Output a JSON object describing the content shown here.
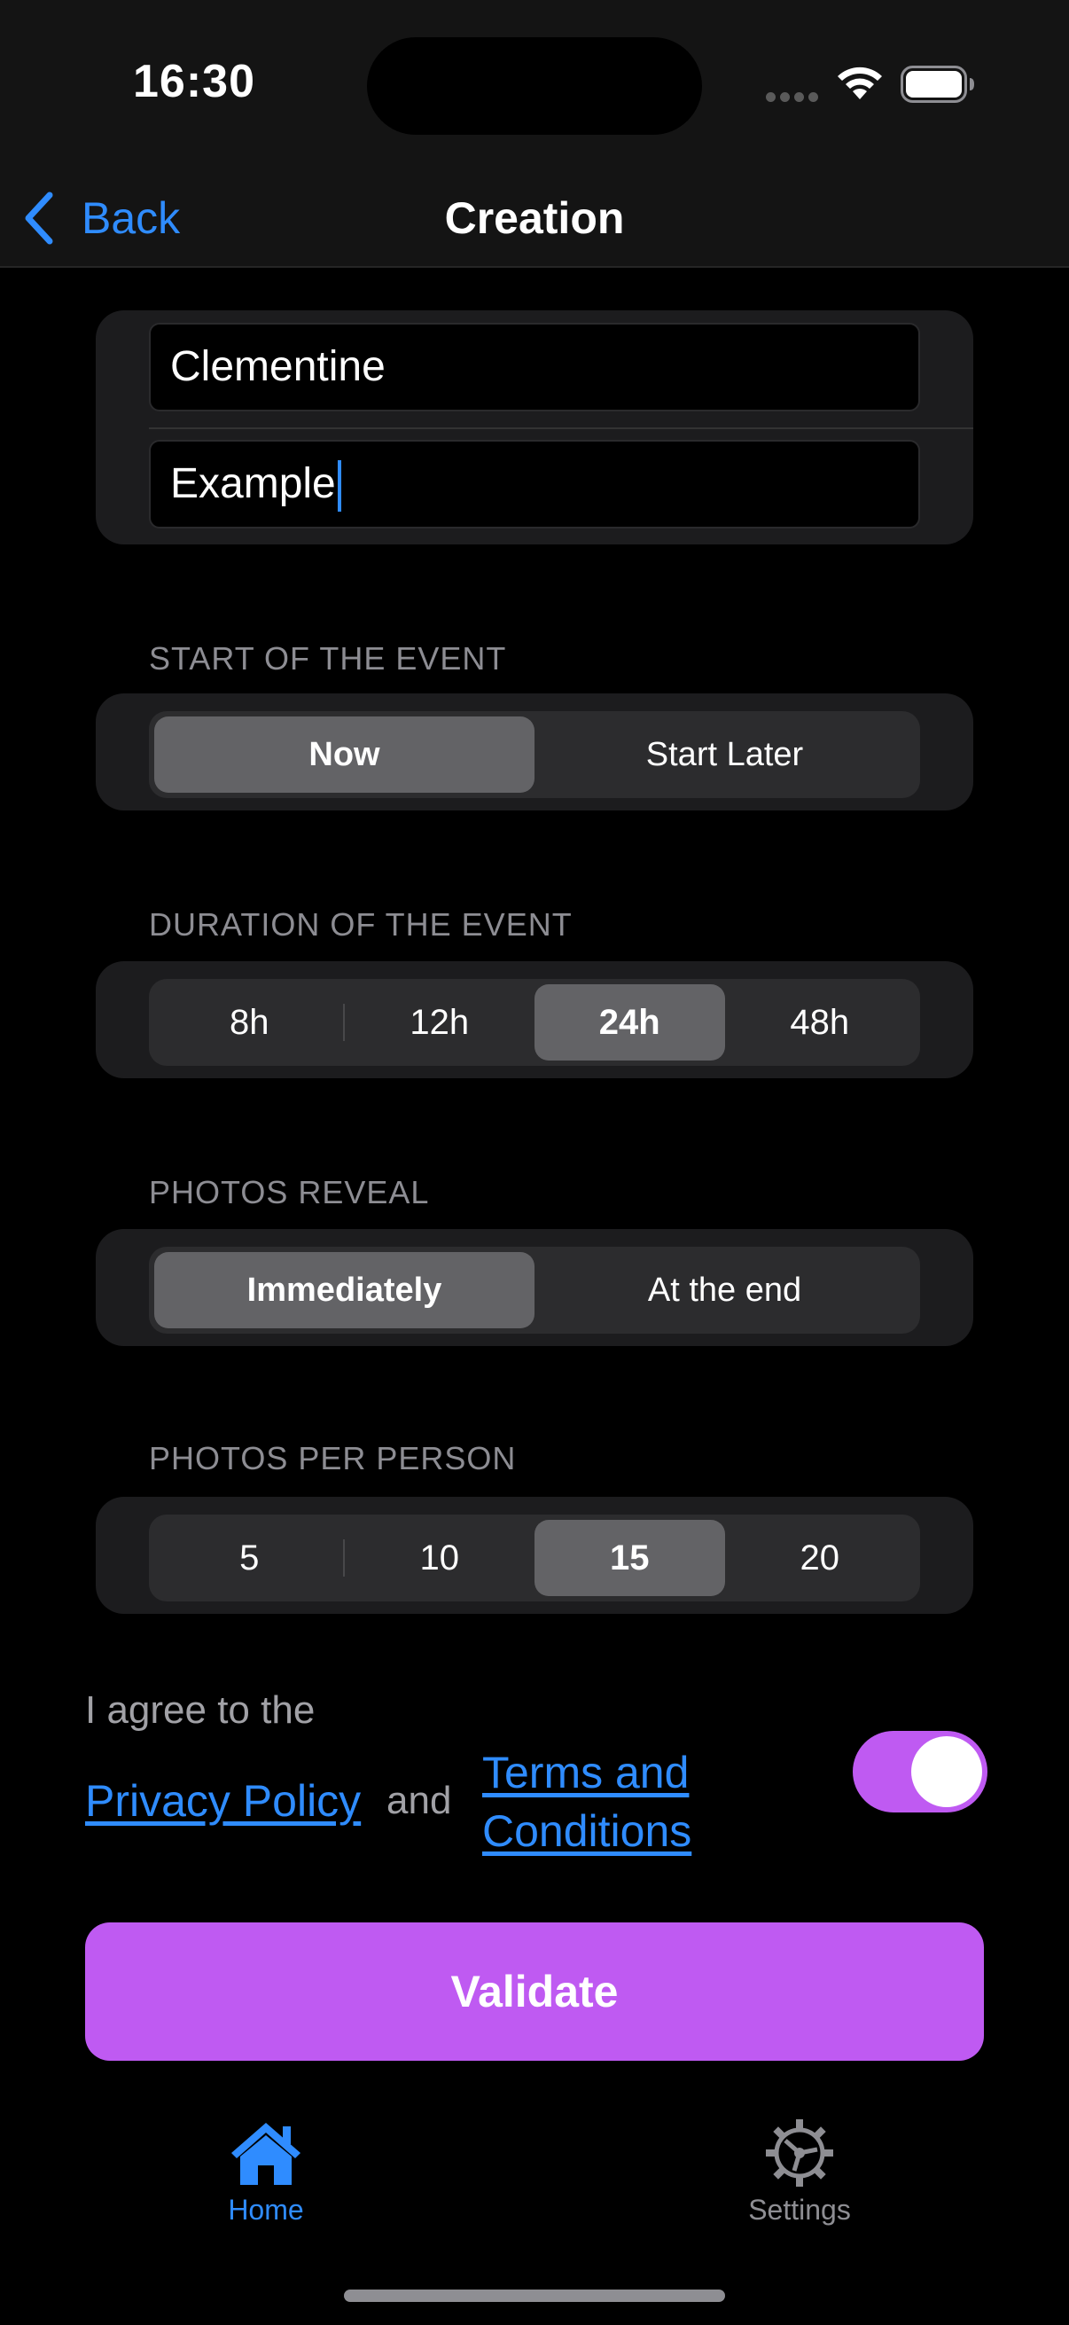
{
  "status": {
    "time": "16:30"
  },
  "nav": {
    "back_label": "Back",
    "title": "Creation"
  },
  "form": {
    "name_value": "Clementine",
    "description_value": "Example"
  },
  "start": {
    "label": "START OF THE EVENT",
    "options": [
      "Now",
      "Start Later"
    ],
    "selected": "Now"
  },
  "duration": {
    "label": "DURATION OF THE EVENT",
    "options": [
      "8h",
      "12h",
      "24h",
      "48h"
    ],
    "selected": "24h"
  },
  "reveal": {
    "label": "PHOTOS REVEAL",
    "options": [
      "Immediately",
      "At the end"
    ],
    "selected": "Immediately"
  },
  "photos": {
    "label": "PHOTOS PER PERSON",
    "options": [
      "5",
      "10",
      "15",
      "20"
    ],
    "selected": "15"
  },
  "agreement": {
    "prefix": "I agree to the",
    "privacy": "Privacy Policy",
    "and": "and",
    "terms_line1": "Terms and",
    "terms_line2": "Conditions",
    "enabled": true
  },
  "validate_label": "Validate",
  "tabs": [
    {
      "label": "Home",
      "icon": "house-icon",
      "active": true
    },
    {
      "label": "Settings",
      "icon": "gear-icon",
      "active": false
    }
  ],
  "colors": {
    "accent": "#bf5af2",
    "link": "#2f8cff",
    "tab_active": "#2f8cff",
    "tab_inactive": "#8e8e93"
  }
}
